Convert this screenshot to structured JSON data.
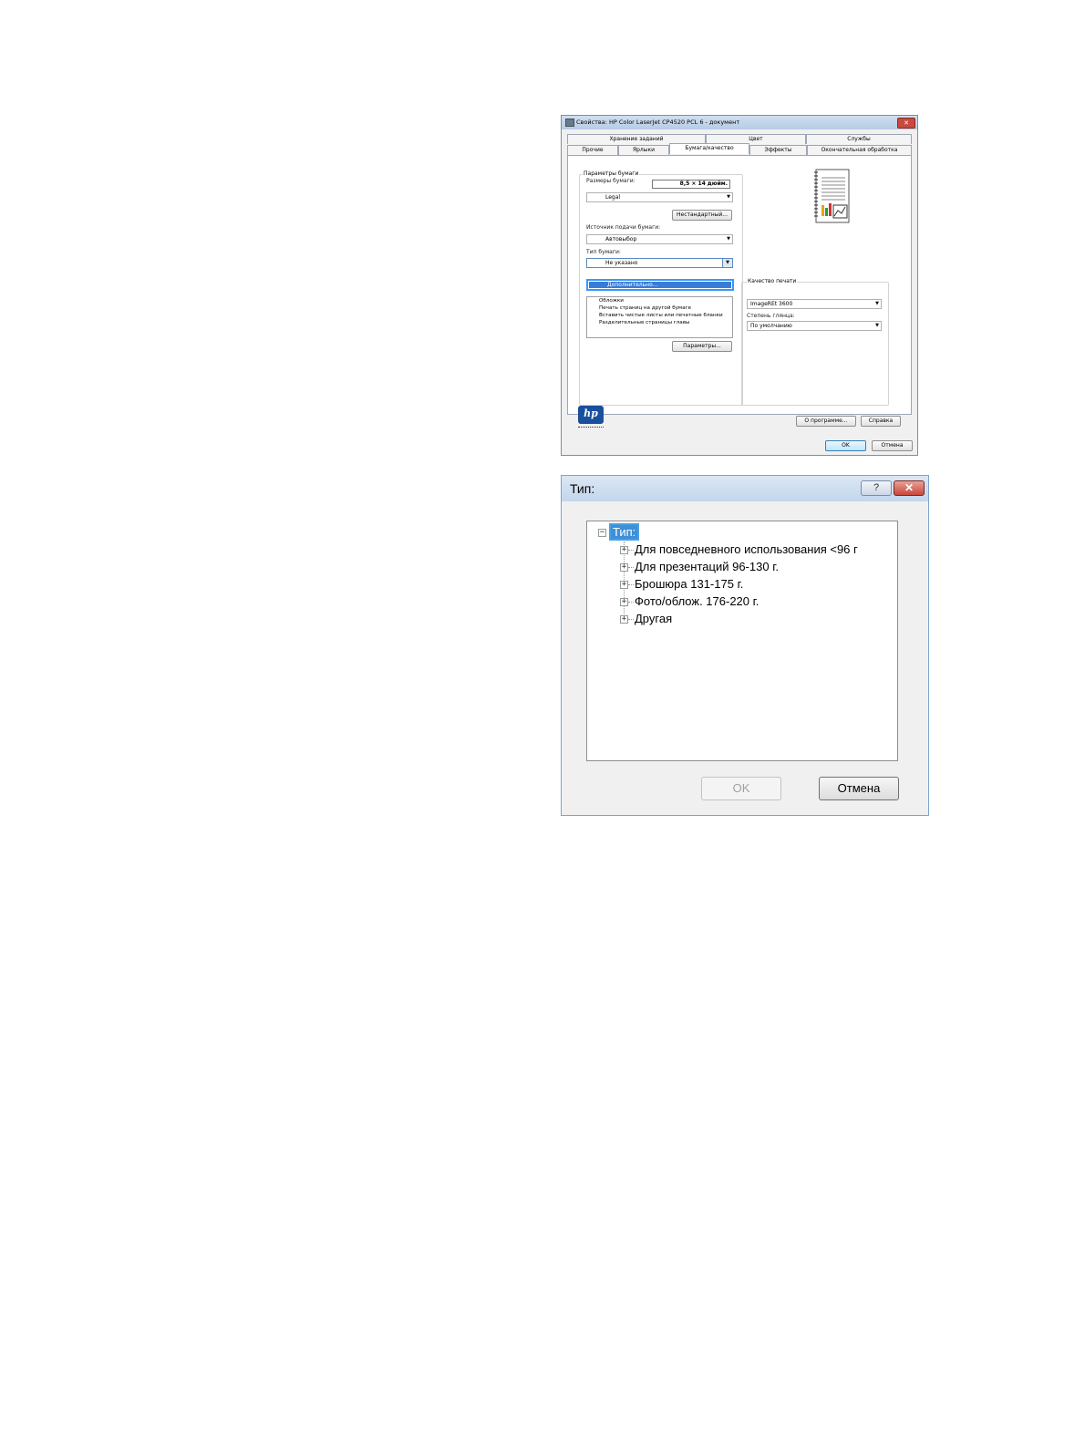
{
  "printer_dialog": {
    "title": "Свойства: HP Color LaserJet CP4520 PCL 6 - документ",
    "tabs_back": [
      "Хранение заданий",
      "Цвет",
      "Службы"
    ],
    "tabs_front": [
      "Прочие",
      "Ярлыки",
      "Бумага/качество",
      "Эффекты",
      "Окончательная обработка"
    ],
    "active_tab": "Бумага/качество",
    "paper_options": {
      "legend": "Параметры бумаги",
      "size_label": "Размеры бумаги:",
      "size_value": "8,5 × 14 дюйм.",
      "size_select": "Legal",
      "custom_button": "Нестандартный...",
      "source_label": "Источник подачи бумаги:",
      "source_select": "Автовыбор",
      "type_label": "Тип бумаги:",
      "type_select": "Не указано",
      "highlighted_option": "Дополнительно...",
      "special_pages": [
        "Обложки",
        "Печать страниц на другой бумаге",
        "Вставить чистые листы или печатные бланки",
        "Разделительные страницы главы"
      ],
      "settings_button": "Параметры..."
    },
    "print_quality": {
      "legend": "Качество печати",
      "quality_select": "ImageREt 3600",
      "gloss_label": "Степень глянца:",
      "gloss_select": "По умолчанию"
    },
    "logo_text": "hp",
    "about_button": "О программе...",
    "help_button": "Справка",
    "ok_button": "OK",
    "cancel_button": "Отмена"
  },
  "type_dialog": {
    "title": "Тип:",
    "help_glyph": "?",
    "close_glyph": "✕",
    "root": "Тип:",
    "items": [
      "Для повседневного использования <96 г",
      "Для презентаций 96-130 г.",
      "Брошюра 131-175 г.",
      "Фото/облож. 176-220 г.",
      "Другая"
    ],
    "ok_button": "OK",
    "cancel_button": "Отмена"
  }
}
